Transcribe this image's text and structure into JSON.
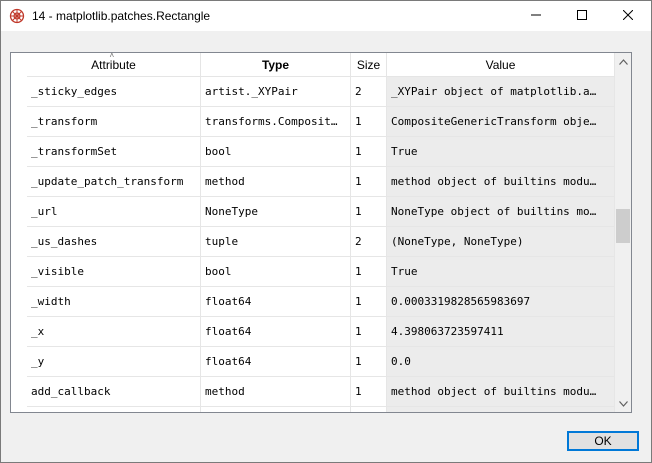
{
  "window": {
    "title": "14 - matplotlib.patches.Rectangle",
    "icons": {
      "app": "spyder-web-icon",
      "minimize": "minimize-icon",
      "maximize": "maximize-icon",
      "close": "close-icon"
    }
  },
  "table": {
    "columns": [
      "Attribute",
      "Type",
      "Size",
      "Value"
    ],
    "sorted_column": "Attribute",
    "rows": [
      {
        "attribute": "_sticky_edges",
        "type": "artist._XYPair",
        "size": "2",
        "value": "_XYPair object of matplotlib.a…"
      },
      {
        "attribute": "_transform",
        "type": "transforms.Composit…",
        "size": "1",
        "value": "CompositeGenericTransform obje…"
      },
      {
        "attribute": "_transformSet",
        "type": "bool",
        "size": "1",
        "value": "True"
      },
      {
        "attribute": "_update_patch_transform",
        "type": "method",
        "size": "1",
        "value": "method object of builtins modu…"
      },
      {
        "attribute": "_url",
        "type": "NoneType",
        "size": "1",
        "value": "NoneType object of builtins mo…"
      },
      {
        "attribute": "_us_dashes",
        "type": "tuple",
        "size": "2",
        "value": "(NoneType, NoneType)"
      },
      {
        "attribute": "_visible",
        "type": "bool",
        "size": "1",
        "value": "True"
      },
      {
        "attribute": "_width",
        "type": "float64",
        "size": "1",
        "value": "0.0003319828565983697"
      },
      {
        "attribute": "_x",
        "type": "float64",
        "size": "1",
        "value": "4.398063723597411"
      },
      {
        "attribute": "_y",
        "type": "float64",
        "size": "1",
        "value": "0.0"
      },
      {
        "attribute": "add_callback",
        "type": "method",
        "size": "1",
        "value": "method object of builtins modu…"
      }
    ]
  },
  "footer": {
    "ok_label": "OK"
  }
}
